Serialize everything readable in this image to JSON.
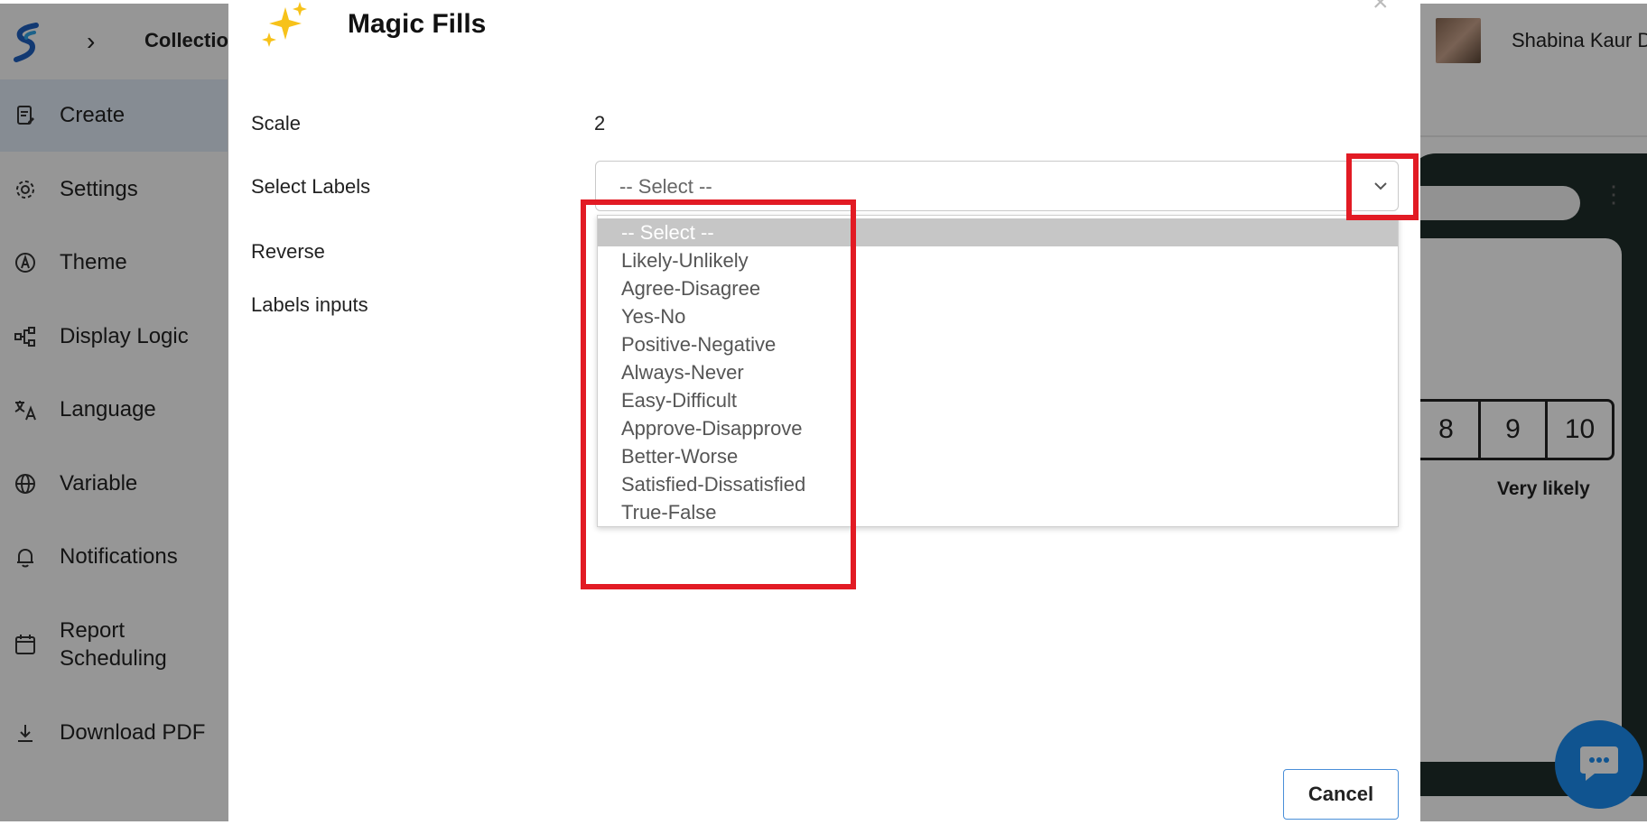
{
  "breadcrumb": {
    "chevron": "›",
    "collection_text": "Collectio"
  },
  "user": {
    "name": "Shabina Kaur D"
  },
  "sidebar": {
    "items": [
      {
        "label": "Create",
        "icon": "edit-document-icon",
        "active": true
      },
      {
        "label": "Settings",
        "icon": "gear-icon"
      },
      {
        "label": "Theme",
        "icon": "theme-icon"
      },
      {
        "label": "Display Logic",
        "icon": "flow-icon"
      },
      {
        "label": "Language",
        "icon": "translate-icon"
      },
      {
        "label": "Variable",
        "icon": "globe-icon"
      },
      {
        "label": "Notifications",
        "icon": "bell-icon"
      },
      {
        "label": "Report Scheduling",
        "icon": "calendar-icon"
      },
      {
        "label": "Download PDF",
        "icon": "download-icon"
      }
    ]
  },
  "preview": {
    "scale_numbers": [
      "8",
      "9",
      "10"
    ],
    "end_label": "Very likely"
  },
  "modal": {
    "title": "Magic Fills",
    "close_icon": "×",
    "fields": {
      "scale_label": "Scale",
      "scale_value": "2",
      "select_labels_label": "Select Labels",
      "reverse_label": "Reverse",
      "labels_inputs_label": "Labels inputs"
    },
    "select": {
      "placeholder": "-- Select --",
      "options": [
        "-- Select --",
        "Likely-Unlikely",
        "Agree-Disagree",
        "Yes-No",
        "Positive-Negative",
        "Always-Never",
        "Easy-Difficult",
        "Approve-Disapprove",
        "Better-Worse",
        "Satisfied-Dissatisfied",
        "True-False"
      ],
      "highlighted_index": 0
    },
    "cancel_label": "Cancel"
  },
  "colors": {
    "highlight_red": "#e21b24",
    "chat_blue": "#1b8df0",
    "sidebar_active": "#dfe9f6",
    "overlay": "rgba(0,0,0,0.40)"
  }
}
